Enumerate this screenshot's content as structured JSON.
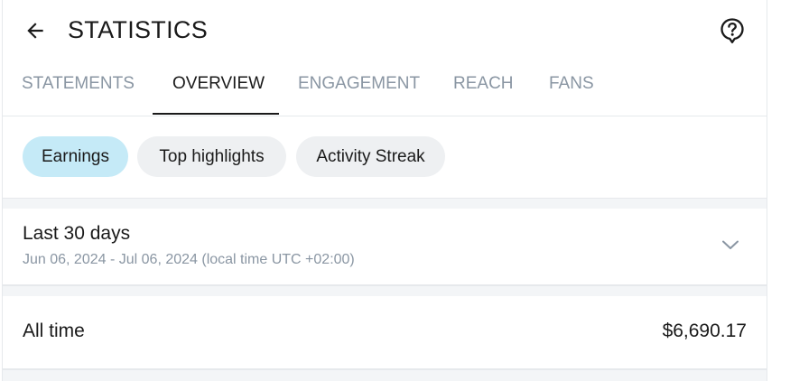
{
  "header": {
    "title": "STATISTICS",
    "back_icon": "arrow-left-icon",
    "help_icon": "help-circle-icon"
  },
  "tabs": [
    {
      "label": "STATEMENTS",
      "active": false
    },
    {
      "label": "OVERVIEW",
      "active": true
    },
    {
      "label": "ENGAGEMENT",
      "active": false
    },
    {
      "label": "REACH",
      "active": false
    },
    {
      "label": "FANS",
      "active": false
    }
  ],
  "chips": [
    {
      "label": "Earnings",
      "selected": true
    },
    {
      "label": "Top highlights",
      "selected": false
    },
    {
      "label": "Activity Streak",
      "selected": false
    }
  ],
  "period": {
    "title": "Last 30 days",
    "range": "Jun 06, 2024 - Jul 06, 2024 (local time UTC +02:00)",
    "chevron_icon": "chevron-down-icon"
  },
  "all_time": {
    "label": "All time",
    "value": "$6,690.17"
  },
  "colors": {
    "text_primary": "#1a1a1a",
    "text_muted": "#8a96a3",
    "chip_selected_bg": "#c5eaf7",
    "chip_bg": "#eef0f2",
    "divider": "#e6e9ec",
    "band_bg": "#f3f5f7"
  }
}
